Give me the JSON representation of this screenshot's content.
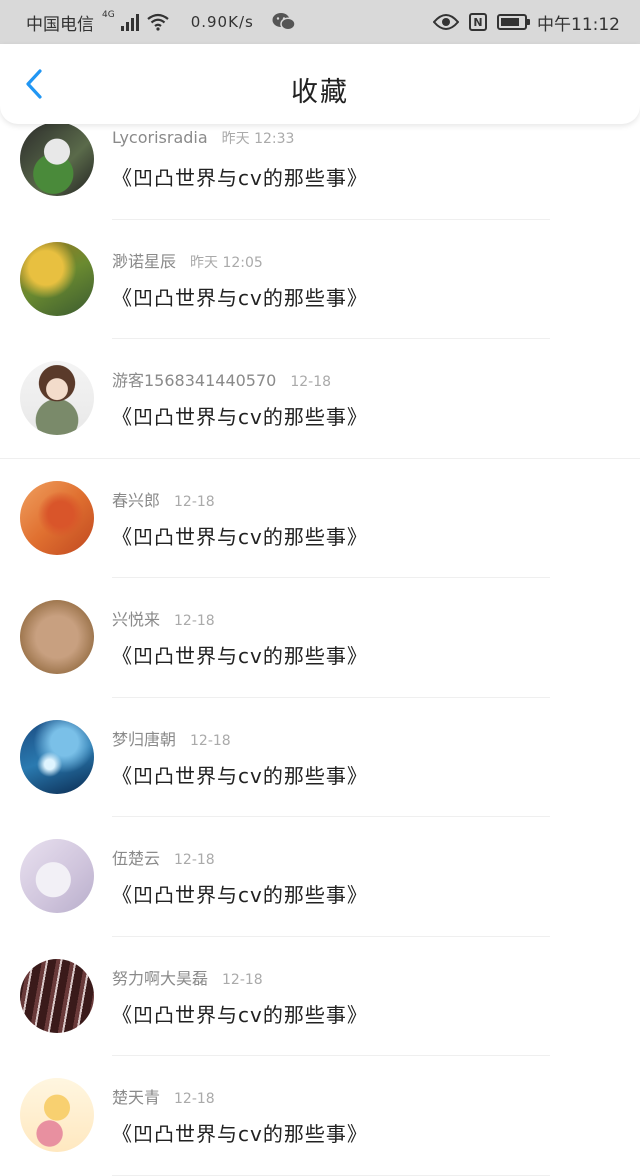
{
  "status_bar": {
    "carrier": "中国电信",
    "network": "4G",
    "speed": "0.90K/s",
    "time": "中午11:12",
    "icons": [
      "signal-icon",
      "wifi-icon",
      "wechat-icon",
      "eye-icon",
      "nfc-icon",
      "battery-icon"
    ],
    "battery_level": 0.8
  },
  "header": {
    "back_icon": "chevron-left-icon",
    "title": "收藏",
    "accent": "#2196f3"
  },
  "items": [
    {
      "name": "Lycorisradia",
      "time": "昨天 12:33",
      "content": "《凹凸世界与cv的那些事》"
    },
    {
      "name": "渺诺星辰",
      "time": "昨天 12:05",
      "content": "《凹凸世界与cv的那些事》"
    },
    {
      "name": "游客1568341440570",
      "time": "12-18",
      "content": "《凹凸世界与cv的那些事》"
    },
    {
      "name": "春兴郎",
      "time": "12-18",
      "content": "《凹凸世界与cv的那些事》"
    },
    {
      "name": "兴悦来",
      "time": "12-18",
      "content": "《凹凸世界与cv的那些事》"
    },
    {
      "name": "梦归唐朝",
      "time": "12-18",
      "content": "《凹凸世界与cv的那些事》"
    },
    {
      "name": "伍楚云",
      "time": "12-18",
      "content": "《凹凸世界与cv的那些事》"
    },
    {
      "name": "努力啊大昊磊",
      "time": "12-18",
      "content": "《凹凸世界与cv的那些事》"
    },
    {
      "name": "楚天青",
      "time": "12-18",
      "content": "《凹凸世界与cv的那些事》"
    }
  ]
}
